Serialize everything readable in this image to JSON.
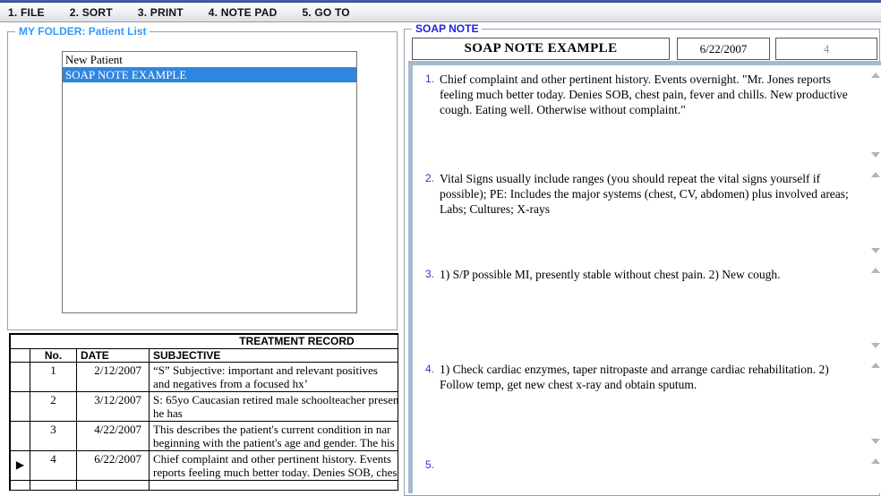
{
  "menu": {
    "items": [
      {
        "label": "1. FILE"
      },
      {
        "label": "2. SORT"
      },
      {
        "label": "3. PRINT"
      },
      {
        "label": "4. NOTE PAD"
      },
      {
        "label": "5. GO TO"
      }
    ]
  },
  "patient_folder": {
    "legend": "MY FOLDER: Patient List",
    "patients": [
      {
        "label": "New Patient",
        "selected": false
      },
      {
        "label": "SOAP NOTE EXAMPLE",
        "selected": true
      }
    ]
  },
  "treatment_record": {
    "title": "TREATMENT RECORD",
    "columns": {
      "no": "No.",
      "date": "DATE",
      "subjective": "SUBJECTIVE"
    },
    "selector_arrow": "▶",
    "rows": [
      {
        "no": "1",
        "date": "2/12/2007",
        "line1": "“S” Subjective: important and relevant positives",
        "line2": "and negatives from a focused hx’"
      },
      {
        "no": "2",
        "date": "3/12/2007",
        "line1": "S: 65yo Caucasian retired male schoolteacher presen",
        "line2": "he has"
      },
      {
        "no": "3",
        "date": "4/22/2007",
        "line1": "This describes the patient's current condition in nar",
        "line2": "beginning with the patient's age and gender. The his"
      },
      {
        "no": "4",
        "date": "6/22/2007",
        "line1": "Chief complaint and other pertinent history. Events",
        "line2": "reports feeling much better today. Denies SOB, ches"
      }
    ]
  },
  "soap_note": {
    "legend": "SOAP NOTE",
    "title": "SOAP NOTE EXAMPLE",
    "date": "6/22/2007",
    "record_number": "4",
    "sections": [
      {
        "number": "1.",
        "text": "Chief complaint and other pertinent history. Events overnight. \"Mr. Jones reports feeling much better today. Denies SOB, chest pain, fever and chills. New productive cough. Eating well. Otherwise without complaint.\""
      },
      {
        "number": "2.",
        "text": "Vital Signs usually include ranges (you should repeat the vital signs yourself if possible); PE: Includes the major systems (chest, CV, abdomen) plus involved areas; Labs; Cultures; X-rays"
      },
      {
        "number": "3.",
        "text": "1) S/P possible MI, presently stable without chest pain. 2) New cough."
      },
      {
        "number": "4.",
        "text": "1) Check cardiac enzymes, taper nitropaste and arrange cardiac rehabilitation. 2) Follow temp, get new chest x-ray and obtain sputum."
      },
      {
        "number": "5.",
        "text": ""
      }
    ]
  },
  "colors": {
    "folder_legend_blue": "#3399ff",
    "soap_legend_blue": "#2222dd",
    "selection_blue": "#2f86e0",
    "section_number_blue": "#3333cc",
    "steel_strip": "#a6bacf",
    "muted_number_gray": "#909090",
    "window_edge_navy": "#27478f"
  }
}
